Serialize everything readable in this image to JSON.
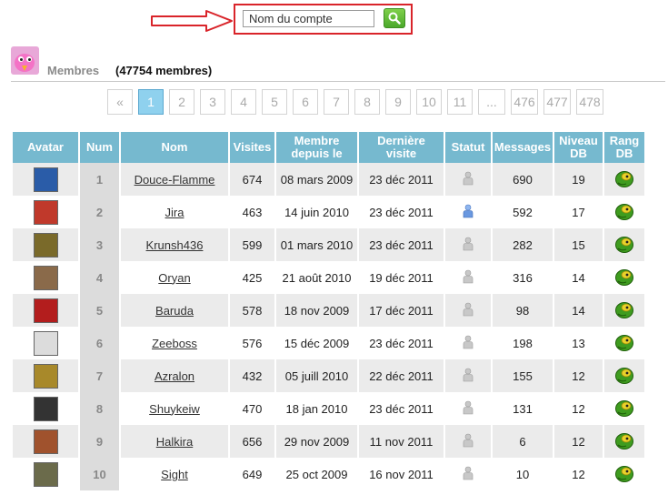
{
  "search": {
    "placeholder": "Nom du compte",
    "value": "Nom du compte"
  },
  "header": {
    "title": "Membres",
    "count": "(47754 membres)"
  },
  "pagination": [
    "«",
    "1",
    "2",
    "3",
    "4",
    "5",
    "6",
    "7",
    "8",
    "9",
    "10",
    "11",
    "...",
    "476",
    "477",
    "478"
  ],
  "pagination_active": "1",
  "table": {
    "headers": {
      "avatar": "Avatar",
      "num": "Num",
      "name": "Nom",
      "visits": "Visites",
      "since_line1": "Membre",
      "since_line2": "depuis le",
      "last_line1": "Dernière",
      "last_line2": "visite",
      "status": "Statut",
      "messages": "Messages",
      "level_line1": "Niveau",
      "level_line2": "DB",
      "rank_line1": "Rang",
      "rank_line2": "DB"
    },
    "rows": [
      {
        "num": "1",
        "name": "Douce-Flamme",
        "visits": "674",
        "since": "08 mars 2009",
        "last": "23 déc 2011",
        "status": "offline",
        "messages": "690",
        "level": "19",
        "avatar_color": "#2a5ca8"
      },
      {
        "num": "2",
        "name": "Jira",
        "visits": "463",
        "since": "14 juin 2010",
        "last": "23 déc 2011",
        "status": "online",
        "messages": "592",
        "level": "17",
        "avatar_color": "#c0392b"
      },
      {
        "num": "3",
        "name": "Krunsh436",
        "visits": "599",
        "since": "01 mars 2010",
        "last": "23 déc 2011",
        "status": "offline",
        "messages": "282",
        "level": "15",
        "avatar_color": "#7a6a2a"
      },
      {
        "num": "4",
        "name": "Oryan",
        "visits": "425",
        "since": "21 août 2010",
        "last": "19 déc 2011",
        "status": "offline",
        "messages": "316",
        "level": "14",
        "avatar_color": "#8a6a4a"
      },
      {
        "num": "5",
        "name": "Baruda",
        "visits": "578",
        "since": "18 nov 2009",
        "last": "17 déc 2011",
        "status": "offline",
        "messages": "98",
        "level": "14",
        "avatar_color": "#b31d1d"
      },
      {
        "num": "6",
        "name": "Zeeboss",
        "visits": "576",
        "since": "15 déc 2009",
        "last": "23 déc 2011",
        "status": "offline",
        "messages": "198",
        "level": "13",
        "avatar_color": "#dcdcdc"
      },
      {
        "num": "7",
        "name": "Azralon",
        "visits": "432",
        "since": "05 juill 2010",
        "last": "22 déc 2011",
        "status": "offline",
        "messages": "155",
        "level": "12",
        "avatar_color": "#a8892a"
      },
      {
        "num": "8",
        "name": "Shuykeiw",
        "visits": "470",
        "since": "18 jan 2010",
        "last": "23 déc 2011",
        "status": "offline",
        "messages": "131",
        "level": "12",
        "avatar_color": "#333333"
      },
      {
        "num": "9",
        "name": "Halkira",
        "visits": "656",
        "since": "29 nov 2009",
        "last": "11 nov 2011",
        "status": "offline",
        "messages": "6",
        "level": "12",
        "avatar_color": "#a0522d"
      },
      {
        "num": "10",
        "name": "Sight",
        "visits": "649",
        "since": "25 oct 2009",
        "last": "16 nov 2011",
        "status": "offline",
        "messages": "10",
        "level": "12",
        "avatar_color": "#6b6b4b"
      }
    ]
  },
  "icons": {
    "arrow": "right-arrow-icon",
    "search": "search-icon",
    "status_offline": "user-offline-icon",
    "status_online": "user-online-icon",
    "rank": "dragon-ball-rank-icon"
  },
  "colors": {
    "header_bg": "#76b9cf",
    "active_page": "#8fd1ee",
    "highlight_border": "#d9242a",
    "search_button": "#5cb833"
  }
}
